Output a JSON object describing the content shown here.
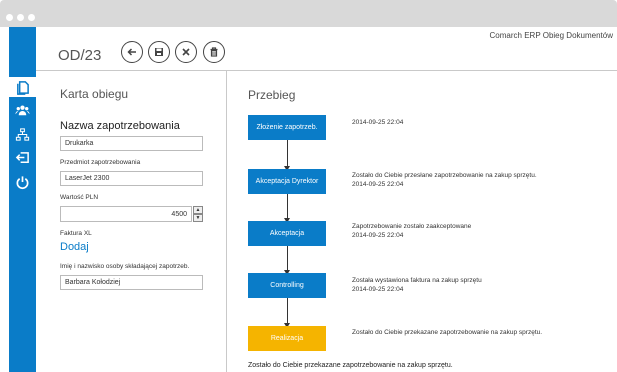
{
  "window": {
    "dots": 3
  },
  "sidebar": {
    "items": [
      {
        "icon": "document-icon",
        "active": true
      },
      {
        "icon": "users-icon",
        "active": false
      },
      {
        "icon": "hierarchy-icon",
        "active": false
      },
      {
        "icon": "logout-icon",
        "active": false
      },
      {
        "icon": "power-icon",
        "active": false
      }
    ]
  },
  "header": {
    "doc_number": "OD/23",
    "buttons": [
      "back-icon",
      "save-icon",
      "close-icon",
      "delete-icon"
    ],
    "app_name": "Comarch ERP Obieg Dokumentów"
  },
  "left": {
    "section_title": "Karta obiegu",
    "form_title": "Nazwa zapotrzebowania",
    "name_value": "Drukarka",
    "subject_label": "Przedmiot zapotrzebowania",
    "subject_value": "LaserJet 2300",
    "value_label": "Wartość PLN",
    "value_amount": "4500",
    "invoice_label": "Faktura XL",
    "add_link": "Dodaj",
    "person_label": "Imię i nazwisko osoby składającej zapotrzeb.",
    "person_value": "Barbara Kołodziej"
  },
  "right": {
    "section_title": "Przebieg",
    "steps": [
      {
        "label": "Złożenie zapotrzeb.",
        "color": "#0a7cc8",
        "message": "",
        "date": "2014-09-25 22:04"
      },
      {
        "label": "Akceptacja Dyrektor",
        "color": "#0a7cc8",
        "message": "Zostało do Ciebie przesłane zapotrzebowanie na zakup sprzętu.",
        "date": "2014-09-25 22:04"
      },
      {
        "label": "Akceptacja",
        "color": "#0a7cc8",
        "message": "Zapotrzebowanie zostało zaakceptowane",
        "date": "2014-09-25 22:04"
      },
      {
        "label": "Controlling",
        "color": "#0a7cc8",
        "message": "Została wystawiona faktura na zakup sprzętu",
        "date": "2014-09-25 22:04"
      },
      {
        "label": "Realizacja",
        "color": "#f5b400",
        "message": "Zostało do Ciebie przekazane zapotrzebowanie na zakup sprzętu.",
        "date": ""
      }
    ],
    "footer": "Zostało do Ciebie przekazane zapotrzebowanie na zakup sprzętu."
  },
  "colors": {
    "accent": "#0a7cc8",
    "highlight": "#f5b400",
    "chrome": "#d9d9d9"
  }
}
